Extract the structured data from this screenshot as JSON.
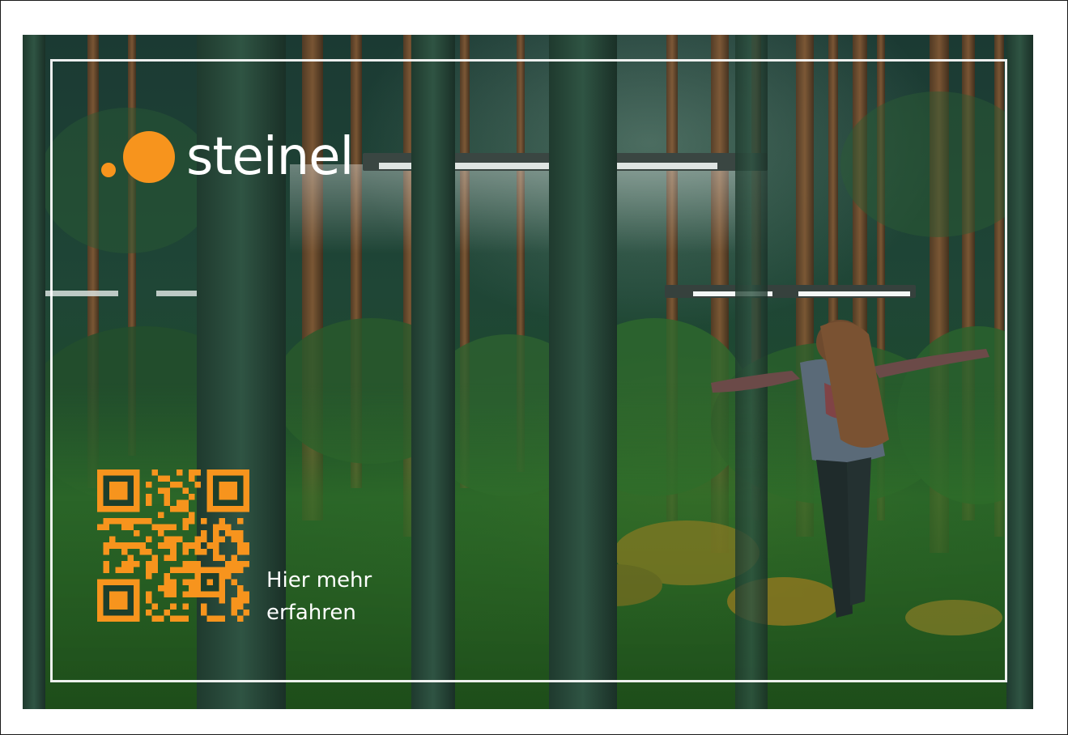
{
  "brand": {
    "name": "steinel",
    "accent": "#f7941d",
    "text_color": "#ffffff"
  },
  "cta": {
    "line1": "Hier mehr",
    "line2": "erfahren"
  },
  "qr_code": {
    "icon": "qr-code-icon",
    "color": "#f7941d"
  },
  "colors": {
    "forest_dark": "#163d1e",
    "frame": "#ffffff"
  }
}
